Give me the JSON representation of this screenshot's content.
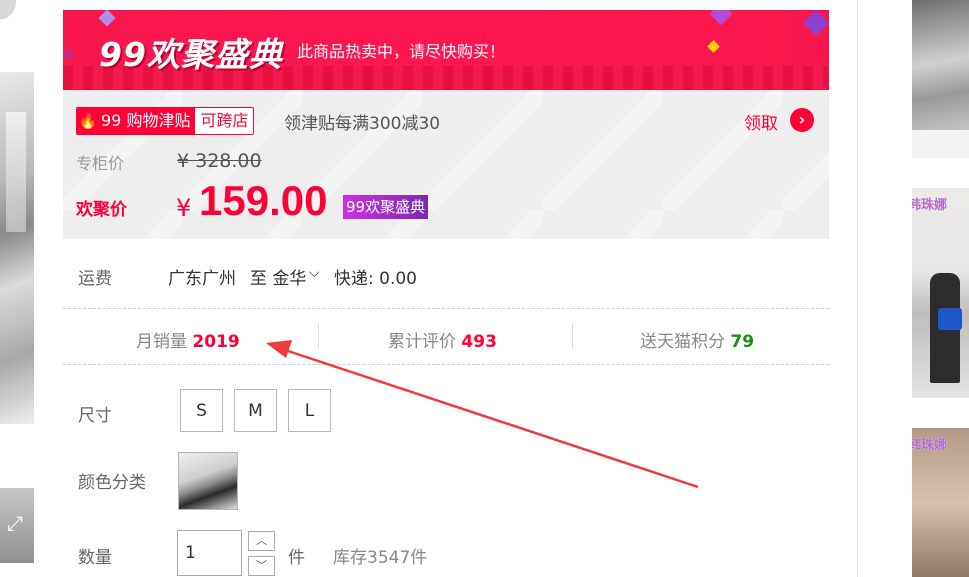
{
  "colors": {
    "accent": "#ff0036",
    "points_green": "#1b8e0e",
    "banner": "#fe1650"
  },
  "promo": {
    "logo": "99欢聚盛典",
    "slogan": "此商品热卖中，请尽快购买！",
    "subsidy_badge": {
      "icon": "fire-icon",
      "left": "99 购物津贴",
      "right": "可跨店"
    },
    "subsidy_text": "领津贴每满300减30",
    "claim_label": "领取",
    "claim_icon": "chevron-right-icon",
    "original_price_label": "专柜价",
    "original_price": "¥ 328.00",
    "sale_price_label": "欢聚价",
    "sale_currency": "¥",
    "sale_price": "159.00",
    "event_tag": "99欢聚盛典"
  },
  "shipping": {
    "label": "运费",
    "from": "广东广州",
    "to": "至 金华",
    "method": "快递: 0.00"
  },
  "stats": {
    "monthly_sales_label": "月销量",
    "monthly_sales_value": "2019",
    "reviews_label": "累计评价",
    "reviews_value": "493",
    "points_label": "送天猫积分",
    "points_value": "79"
  },
  "size": {
    "label": "尺寸",
    "options": [
      "S",
      "M",
      "L"
    ]
  },
  "color": {
    "label": "颜色分类"
  },
  "quantity": {
    "label": "数量",
    "value": "1",
    "unit": "件",
    "stock": "库存3547件"
  },
  "thumbnails": {
    "logo_text": "韩珠娜"
  }
}
